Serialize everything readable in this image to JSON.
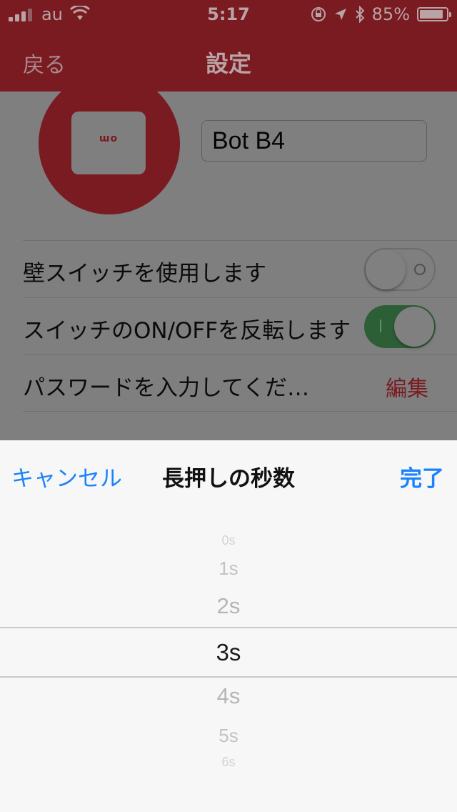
{
  "status_bar": {
    "carrier": "au",
    "time": "5:17",
    "battery_percent": "85%",
    "battery_level": 0.85,
    "icons": [
      "signal-icon",
      "wifi-icon",
      "orientation-lock-icon",
      "location-icon",
      "bluetooth-icon",
      "battery-icon"
    ]
  },
  "nav": {
    "back_label": "戻る",
    "title": "設定"
  },
  "device": {
    "logo_text": "ɯo",
    "name_value": "Bot B4"
  },
  "settings": {
    "rows": [
      {
        "label": "壁スイッチを使用します",
        "toggle_on": false
      },
      {
        "label": "スイッチのON/OFFを反転します",
        "toggle_on": true
      },
      {
        "label": "パスワードを入力してくだ…",
        "action_label": "編集"
      }
    ]
  },
  "picker": {
    "cancel_label": "キャンセル",
    "title": "長押しの秒数",
    "done_label": "完了",
    "options": [
      "0s",
      "1s",
      "2s",
      "3s",
      "4s",
      "5s",
      "6s"
    ],
    "selected": "3s"
  },
  "colors": {
    "accent_red": "#c8202b",
    "ios_blue": "#1a82fb",
    "toggle_green": "#4cd964"
  }
}
